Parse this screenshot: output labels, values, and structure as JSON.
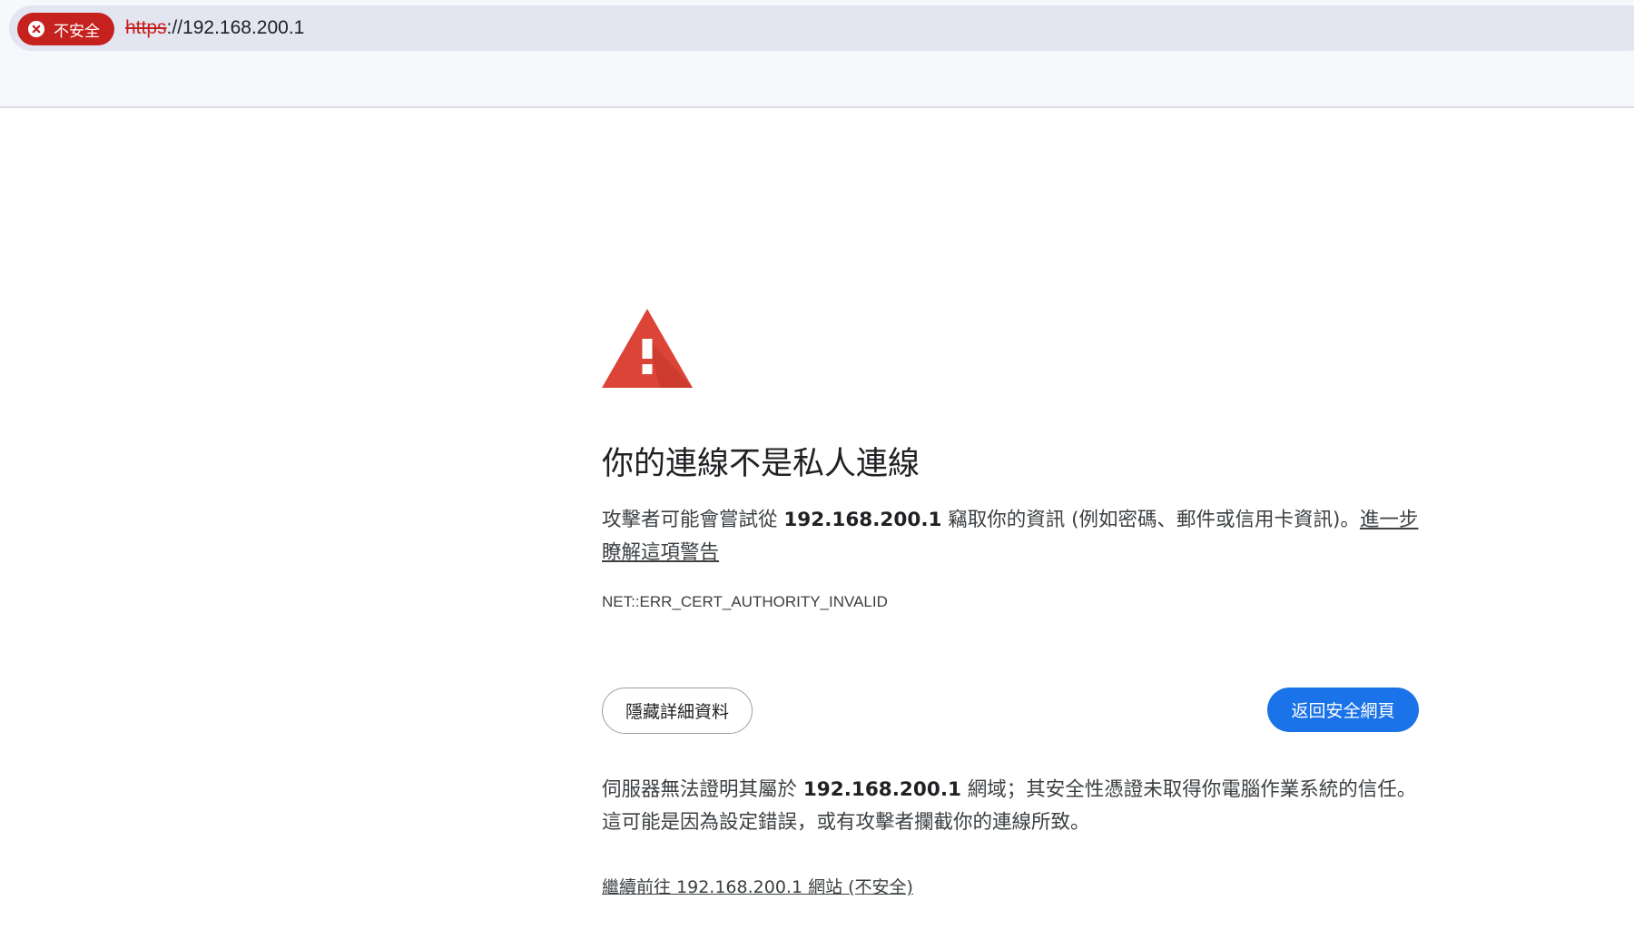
{
  "browser": {
    "security_chip_label": "不安全",
    "url_scheme": "https",
    "url_rest": "://192.168.200.1"
  },
  "interstitial": {
    "title": "你的連線不是私人連線",
    "desc_prefix": "攻擊者可能會嘗試從 ",
    "host": "192.168.200.1",
    "desc_suffix": " 竊取你的資訊 (例如密碼、郵件或信用卡資訊)。",
    "learn_more_link": "進一步瞭解這項警告",
    "error_code": "NET::ERR_CERT_AUTHORITY_INVALID",
    "details_button": "隱藏詳細資料",
    "back_button": "返回安全網頁",
    "details_prefix": "伺服器無法證明其屬於 ",
    "details_suffix": " 網域；其安全性憑證未取得你電腦作業系統的信任。這可能是因為設定錯誤，或有攻擊者攔截你的連線所致。",
    "proceed_link": "繼續前往 192.168.200.1 網站 (不安全)"
  },
  "colors": {
    "danger": "#c5221f",
    "primary": "#1a73e8",
    "warning_icon": "#db4437"
  }
}
